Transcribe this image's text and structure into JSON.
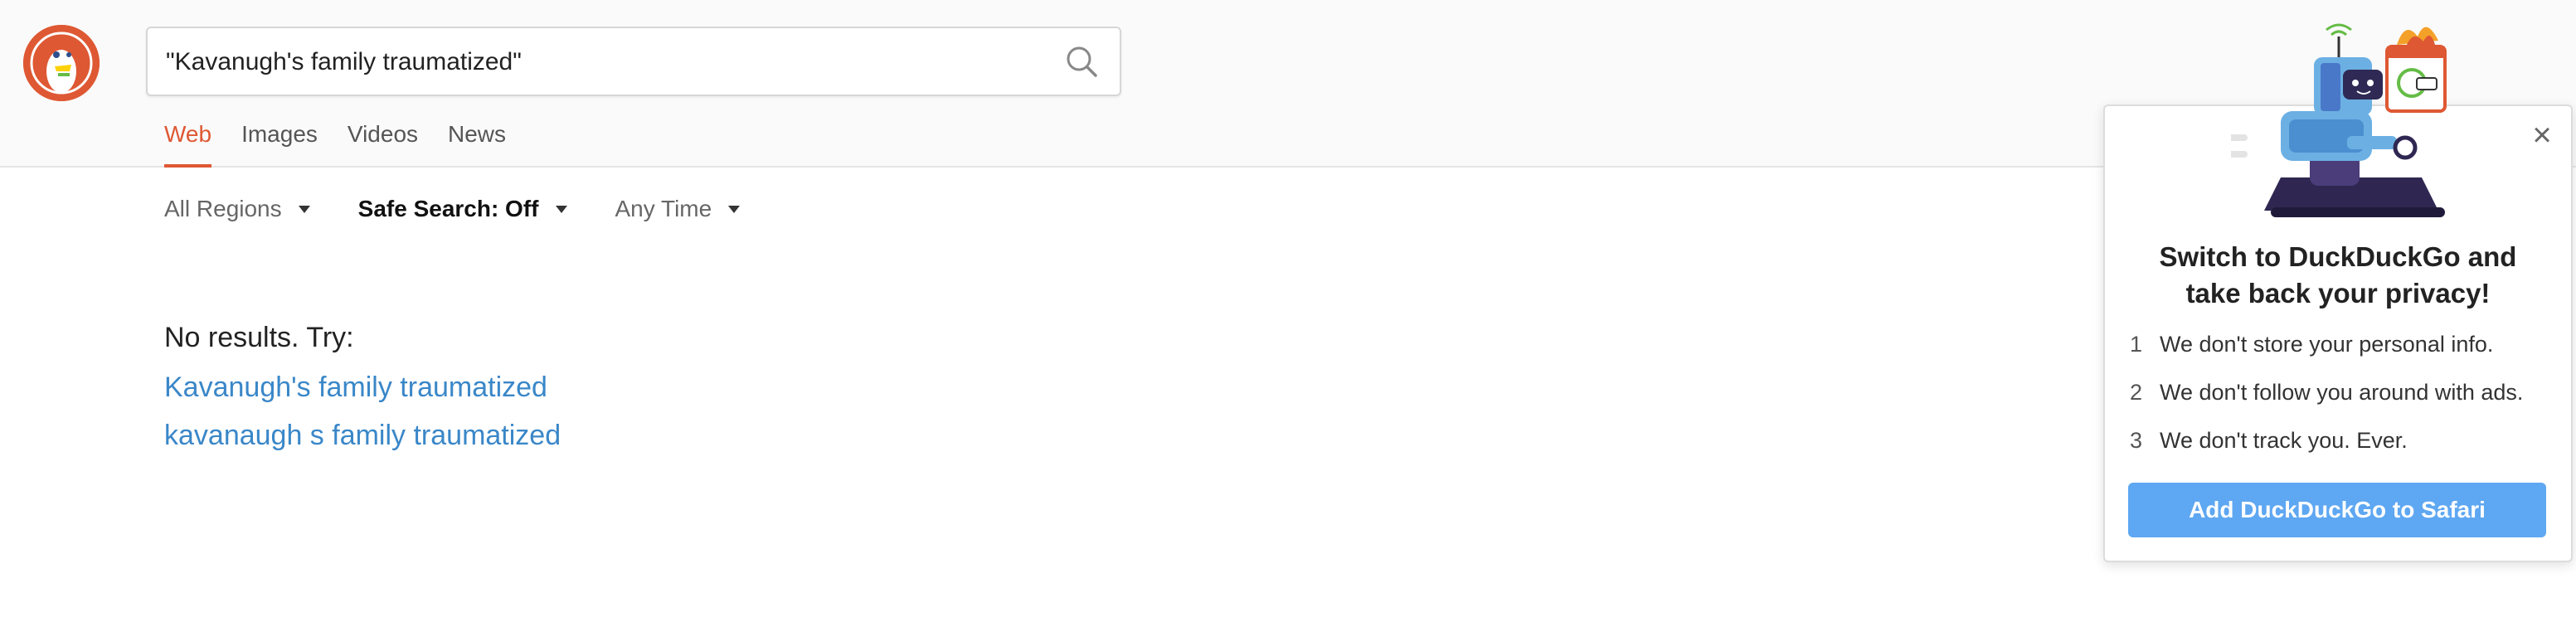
{
  "search": {
    "query": "\"Kavanugh's family traumatized\""
  },
  "tabs": [
    {
      "label": "Web",
      "active": true
    },
    {
      "label": "Images"
    },
    {
      "label": "Videos"
    },
    {
      "label": "News"
    }
  ],
  "filters": {
    "region": "All Regions",
    "safe_search": "Safe Search: Off",
    "time": "Any Time"
  },
  "results": {
    "no_results": "No results. Try:",
    "suggestions": [
      "Kavanugh's family traumatized",
      "kavanaugh s family traumatized"
    ]
  },
  "popup": {
    "title_line1": "Switch to DuckDuckGo and",
    "title_line2": "take back your privacy!",
    "points": [
      {
        "num": "1",
        "text": "We don't store your personal info."
      },
      {
        "num": "2",
        "text": "We don't follow you around with ads."
      },
      {
        "num": "3",
        "text": "We don't track you. Ever."
      }
    ],
    "cta": "Add DuckDuckGo to Safari",
    "close_label": "×"
  },
  "colors": {
    "accent": "#de5833",
    "link": "#3a87c8",
    "cta": "#5ea7f2"
  }
}
